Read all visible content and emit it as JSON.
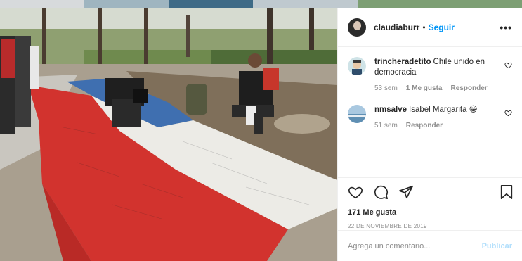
{
  "post": {
    "username": "claudiaburr",
    "separator": "•",
    "follow_label": "Seguir",
    "more_label": "•••"
  },
  "comments": [
    {
      "username": "trincheradetito",
      "text": "Chile unido en democracia",
      "age": "53 sem",
      "likes": "1 Me gusta",
      "reply": "Responder"
    },
    {
      "username": "nmsalve",
      "text": "Isabel Margarita 😀",
      "age": "51 sem",
      "reply": "Responder"
    }
  ],
  "stats": {
    "likes": "171 Me gusta",
    "date": "22 DE NOVIEMBRE DE 2019"
  },
  "comment_box": {
    "placeholder": "Agrega un comentario...",
    "publish_label": "Publicar"
  },
  "colors": {
    "link_blue": "#0095f6",
    "publish_disabled": "#b2dffc",
    "flag_red": "#d2332e",
    "flag_white": "#ecebe6",
    "flag_blue": "#3f6fb0"
  },
  "icons": [
    "heart-icon",
    "comment-icon",
    "share-icon",
    "bookmark-icon",
    "more-options-icon"
  ]
}
